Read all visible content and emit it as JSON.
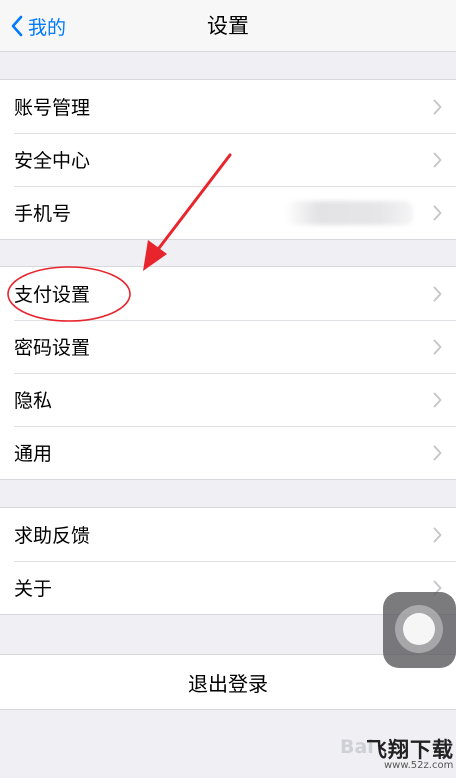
{
  "nav": {
    "back_label": "我的",
    "title": "设置"
  },
  "group1": {
    "items": [
      {
        "label": "账号管理"
      },
      {
        "label": "安全中心"
      },
      {
        "label": "手机号"
      }
    ]
  },
  "group2": {
    "items": [
      {
        "label": "支付设置"
      },
      {
        "label": "密码设置"
      },
      {
        "label": "隐私"
      },
      {
        "label": "通用"
      }
    ]
  },
  "group3": {
    "items": [
      {
        "label": "求助反馈"
      },
      {
        "label": "关于"
      }
    ]
  },
  "logout": {
    "label": "退出登录"
  },
  "watermark": {
    "baidu": "Bai",
    "brand": "飞翔下载",
    "url": "www.52z.com"
  },
  "colors": {
    "accent": "#007aff",
    "annotation": "#e8242c"
  },
  "icons": {
    "back": "chevron-left-icon",
    "row": "chevron-right-icon"
  }
}
